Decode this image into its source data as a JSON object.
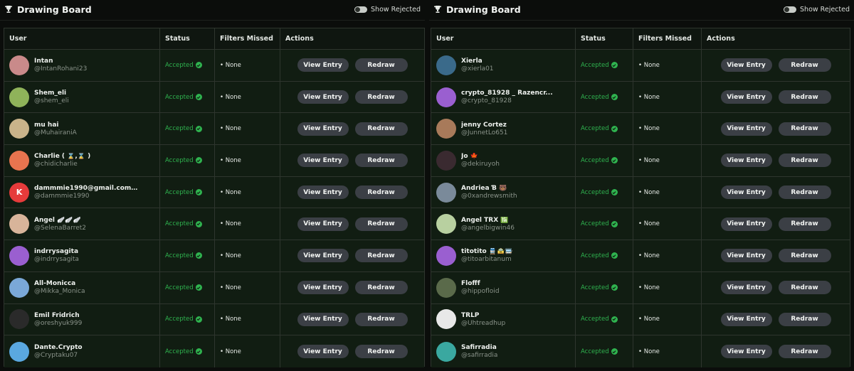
{
  "panels": [
    {
      "title": "Drawing Board",
      "toggle_label": "Show Rejected",
      "columns": {
        "user": "User",
        "status": "Status",
        "filters": "Filters Missed",
        "actions": "Actions"
      },
      "rows": [
        {
          "name": "Intan",
          "handle": "@IntanRohani23",
          "status": "Accepted",
          "filters": "• None",
          "view": "View Entry",
          "redraw": "Redraw",
          "avatar_color": "#c98a8a",
          "avatar_text": ""
        },
        {
          "name": "Shem_eli",
          "handle": "@shem_eli",
          "status": "Accepted",
          "filters": "• None",
          "view": "View Entry",
          "redraw": "Redraw",
          "avatar_color": "#8fb35a",
          "avatar_text": ""
        },
        {
          "name": "mu hai",
          "handle": "@MuhairaniA",
          "status": "Accepted",
          "filters": "• None",
          "view": "View Entry",
          "redraw": "Redraw",
          "avatar_color": "#c9b38a",
          "avatar_text": ""
        },
        {
          "name": "Charlie ( ⌛,⌛ )",
          "handle": "@chidicharlie",
          "status": "Accepted",
          "filters": "• None",
          "view": "View Entry",
          "redraw": "Redraw",
          "avatar_color": "#e8744f",
          "avatar_text": ""
        },
        {
          "name": "dammmie1990@gmail.com#...",
          "handle": "@dammmie1990",
          "status": "Accepted",
          "filters": "• None",
          "view": "View Entry",
          "redraw": "Redraw",
          "avatar_color": "#e63b3b",
          "avatar_text": "K"
        },
        {
          "name": "Angel 🪽🪽🪽",
          "handle": "@SelenaBarret2",
          "status": "Accepted",
          "filters": "• None",
          "view": "View Entry",
          "redraw": "Redraw",
          "avatar_color": "#d8b49a",
          "avatar_text": ""
        },
        {
          "name": "indrrysagita",
          "handle": "@indrrysagita",
          "status": "Accepted",
          "filters": "• None",
          "view": "View Entry",
          "redraw": "Redraw",
          "avatar_color": "#9a5fd0",
          "avatar_text": ""
        },
        {
          "name": "All-Monicca",
          "handle": "@Mikka_Monica",
          "status": "Accepted",
          "filters": "• None",
          "view": "View Entry",
          "redraw": "Redraw",
          "avatar_color": "#7aa8d8",
          "avatar_text": ""
        },
        {
          "name": "Emil Fridrich",
          "handle": "@oreshyuk999",
          "status": "Accepted",
          "filters": "• None",
          "view": "View Entry",
          "redraw": "Redraw",
          "avatar_color": "#2a2a2a",
          "avatar_text": ""
        },
        {
          "name": "Dante.Crypto",
          "handle": "@Cryptaku07",
          "status": "Accepted",
          "filters": "• None",
          "view": "View Entry",
          "redraw": "Redraw",
          "avatar_color": "#5aa8e0",
          "avatar_text": ""
        }
      ]
    },
    {
      "title": "Drawing Board",
      "toggle_label": "Show Rejected",
      "columns": {
        "user": "User",
        "status": "Status",
        "filters": "Filters Missed",
        "actions": "Actions"
      },
      "rows": [
        {
          "name": "Xierla",
          "handle": "@xierla01",
          "status": "Accepted",
          "filters": "• None",
          "view": "View Entry",
          "redraw": "Redraw",
          "avatar_color": "#3a6a8a",
          "avatar_text": ""
        },
        {
          "name": "crypto_81928 _ Razencr...",
          "handle": "@crypto_81928",
          "status": "Accepted",
          "filters": "• None",
          "view": "View Entry",
          "redraw": "Redraw",
          "avatar_color": "#9a5fd0",
          "avatar_text": ""
        },
        {
          "name": "jenny Cortez",
          "handle": "@JunnetLo651",
          "status": "Accepted",
          "filters": "• None",
          "view": "View Entry",
          "redraw": "Redraw",
          "avatar_color": "#a87a5a",
          "avatar_text": ""
        },
        {
          "name": "Jo 🍁",
          "handle": "@dekiruyoh",
          "status": "Accepted",
          "filters": "• None",
          "view": "View Entry",
          "redraw": "Redraw",
          "avatar_color": "#3a2a30",
          "avatar_text": ""
        },
        {
          "name": "Andriea Ɓ 🐻",
          "handle": "@0xandrewsmith",
          "status": "Accepted",
          "filters": "• None",
          "view": "View Entry",
          "redraw": "Redraw",
          "avatar_color": "#7a8a9a",
          "avatar_text": ""
        },
        {
          "name": "Angel TRX 🈯",
          "handle": "@angelbigwin46",
          "status": "Accepted",
          "filters": "• None",
          "view": "View Entry",
          "redraw": "Redraw",
          "avatar_color": "#b8d0a0",
          "avatar_text": ""
        },
        {
          "name": "titotito 🚆🚖🚍",
          "handle": "@titoarbitanum",
          "status": "Accepted",
          "filters": "• None",
          "view": "View Entry",
          "redraw": "Redraw",
          "avatar_color": "#9a5fd0",
          "avatar_text": ""
        },
        {
          "name": "Flofff",
          "handle": "@hippofloid",
          "status": "Accepted",
          "filters": "• None",
          "view": "View Entry",
          "redraw": "Redraw",
          "avatar_color": "#5a6a4a",
          "avatar_text": ""
        },
        {
          "name": "TRLP",
          "handle": "@Uhtreadhup",
          "status": "Accepted",
          "filters": "• None",
          "view": "View Entry",
          "redraw": "Redraw",
          "avatar_color": "#e8e8e8",
          "avatar_text": ""
        },
        {
          "name": "Safirradia",
          "handle": "@safirradia",
          "status": "Accepted",
          "filters": "• None",
          "view": "View Entry",
          "redraw": "Redraw",
          "avatar_color": "#3aa8a0",
          "avatar_text": ""
        }
      ]
    }
  ]
}
